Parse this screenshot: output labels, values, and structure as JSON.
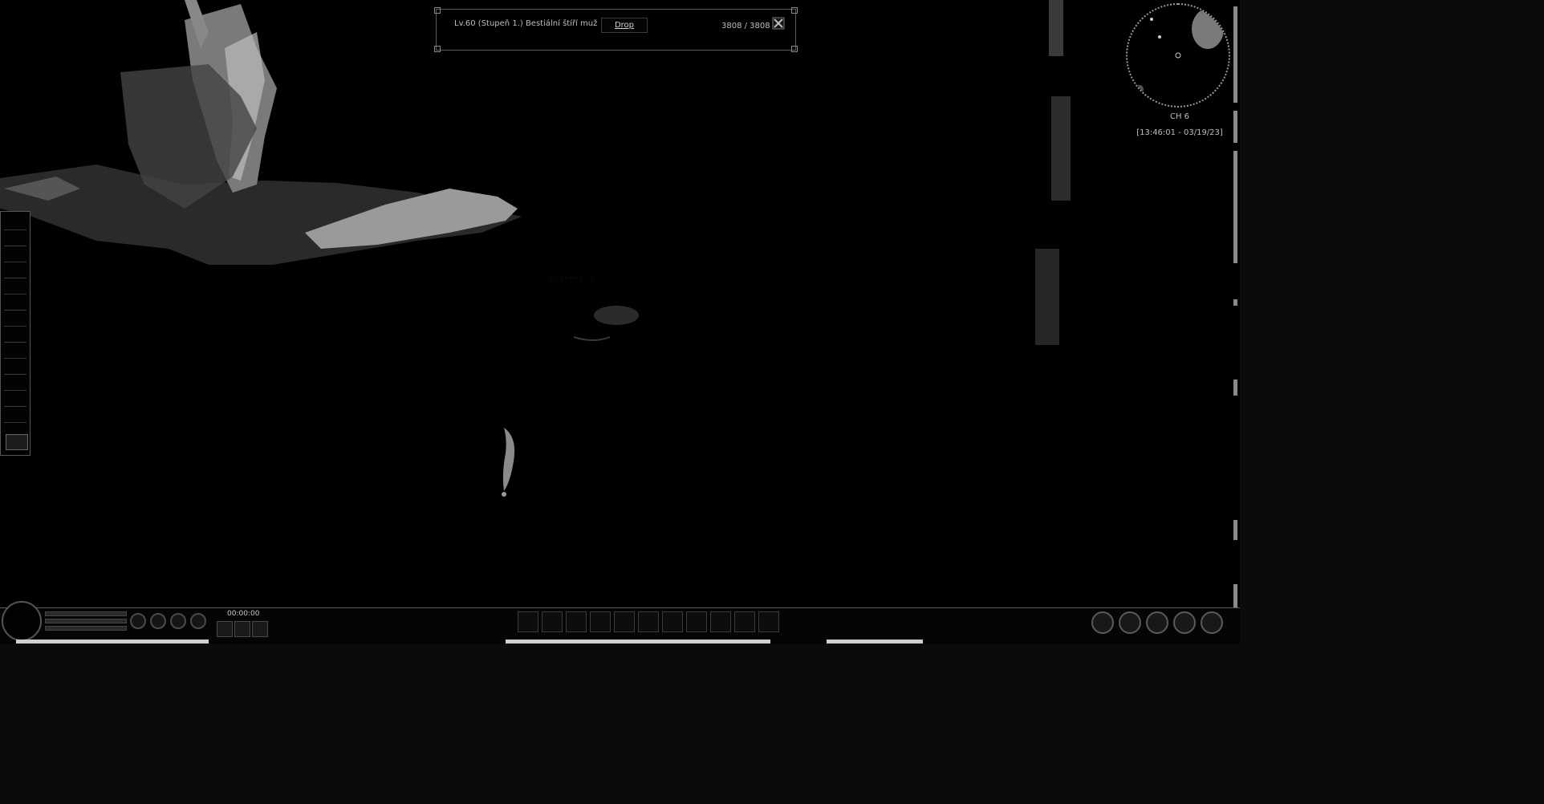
{
  "target": {
    "name": "Lv.60 (Stupeň 1.) Bestiální štíří muž",
    "drop_label": "Drop",
    "hp_text": "3808 / 3808",
    "hp_fraction": 1.0
  },
  "minimap": {
    "channel": "CH 6",
    "clock": "[13:46:01 - 03/19/23]"
  },
  "hud": {
    "timer": "00:00:00"
  },
  "icons": {
    "close": "crossed-swords-close-icon",
    "portrait": "character-portrait",
    "system_buttons": [
      "system-icon-1",
      "system-icon-2",
      "system-icon-3",
      "system-icon-4",
      "system-icon-5"
    ]
  },
  "colors": {
    "background": "#000000",
    "outside": "#0b0b0b",
    "hud_border": "#5c5c5c",
    "text": "#c8c8c8"
  }
}
